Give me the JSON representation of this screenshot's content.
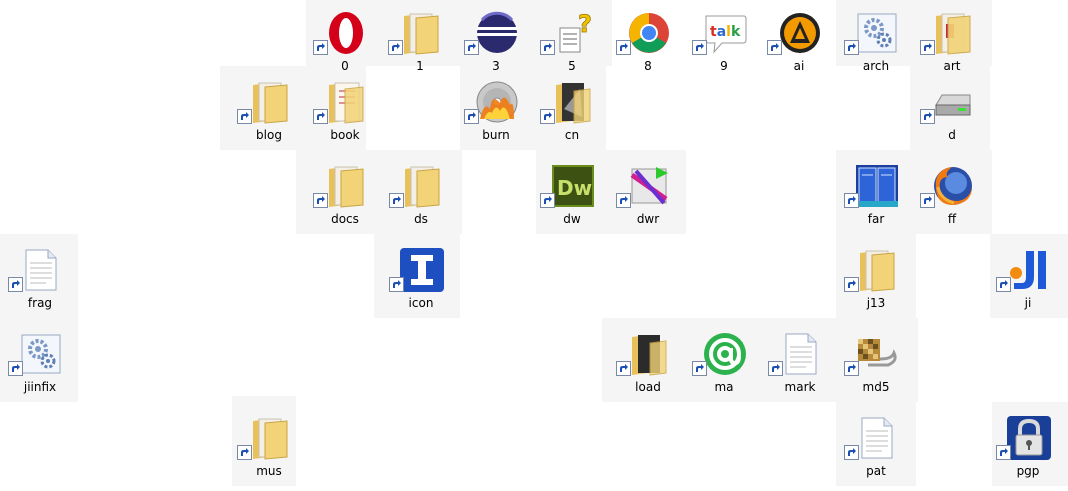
{
  "icons": [
    {
      "label": "0",
      "icon": "opera-icon"
    },
    {
      "label": "1",
      "icon": "folder-icon"
    },
    {
      "label": "3",
      "icon": "eclipse-icon"
    },
    {
      "label": "5",
      "icon": "help-doc-icon"
    },
    {
      "label": "8",
      "icon": "chrome-icon"
    },
    {
      "label": "9",
      "icon": "talk-icon"
    },
    {
      "label": "ai",
      "icon": "aimp-icon"
    },
    {
      "label": "arch",
      "icon": "gear-doc-icon"
    },
    {
      "label": "art",
      "icon": "folder-icon"
    },
    {
      "label": "blog",
      "icon": "folder-icon"
    },
    {
      "label": "book",
      "icon": "folder-icon"
    },
    {
      "label": "burn",
      "icon": "burn-disc-icon"
    },
    {
      "label": "cn",
      "icon": "folder-icon"
    },
    {
      "label": "d",
      "icon": "drive-icon"
    },
    {
      "label": "docs",
      "icon": "folder-icon"
    },
    {
      "label": "ds",
      "icon": "folder-icon"
    },
    {
      "label": "dw",
      "icon": "dreamweaver-icon"
    },
    {
      "label": "dwr",
      "icon": "dwr-icon"
    },
    {
      "label": "far",
      "icon": "far-manager-icon"
    },
    {
      "label": "ff",
      "icon": "firefox-icon"
    },
    {
      "label": "frag",
      "icon": "text-doc-icon"
    },
    {
      "label": "icon",
      "icon": "text-cursor-icon"
    },
    {
      "label": "j13",
      "icon": "folder-icon"
    },
    {
      "label": "ji",
      "icon": "ji-icon"
    },
    {
      "label": "jiinfix",
      "icon": "gear-doc-icon"
    },
    {
      "label": "load",
      "icon": "folder-icon"
    },
    {
      "label": "ma",
      "icon": "mail-at-icon"
    },
    {
      "label": "mark",
      "icon": "text-doc-icon"
    },
    {
      "label": "md5",
      "icon": "md5-icon"
    },
    {
      "label": "mus",
      "icon": "folder-icon"
    },
    {
      "label": "pat",
      "icon": "text-doc-icon"
    },
    {
      "label": "pgp",
      "icon": "lock-icon"
    }
  ]
}
